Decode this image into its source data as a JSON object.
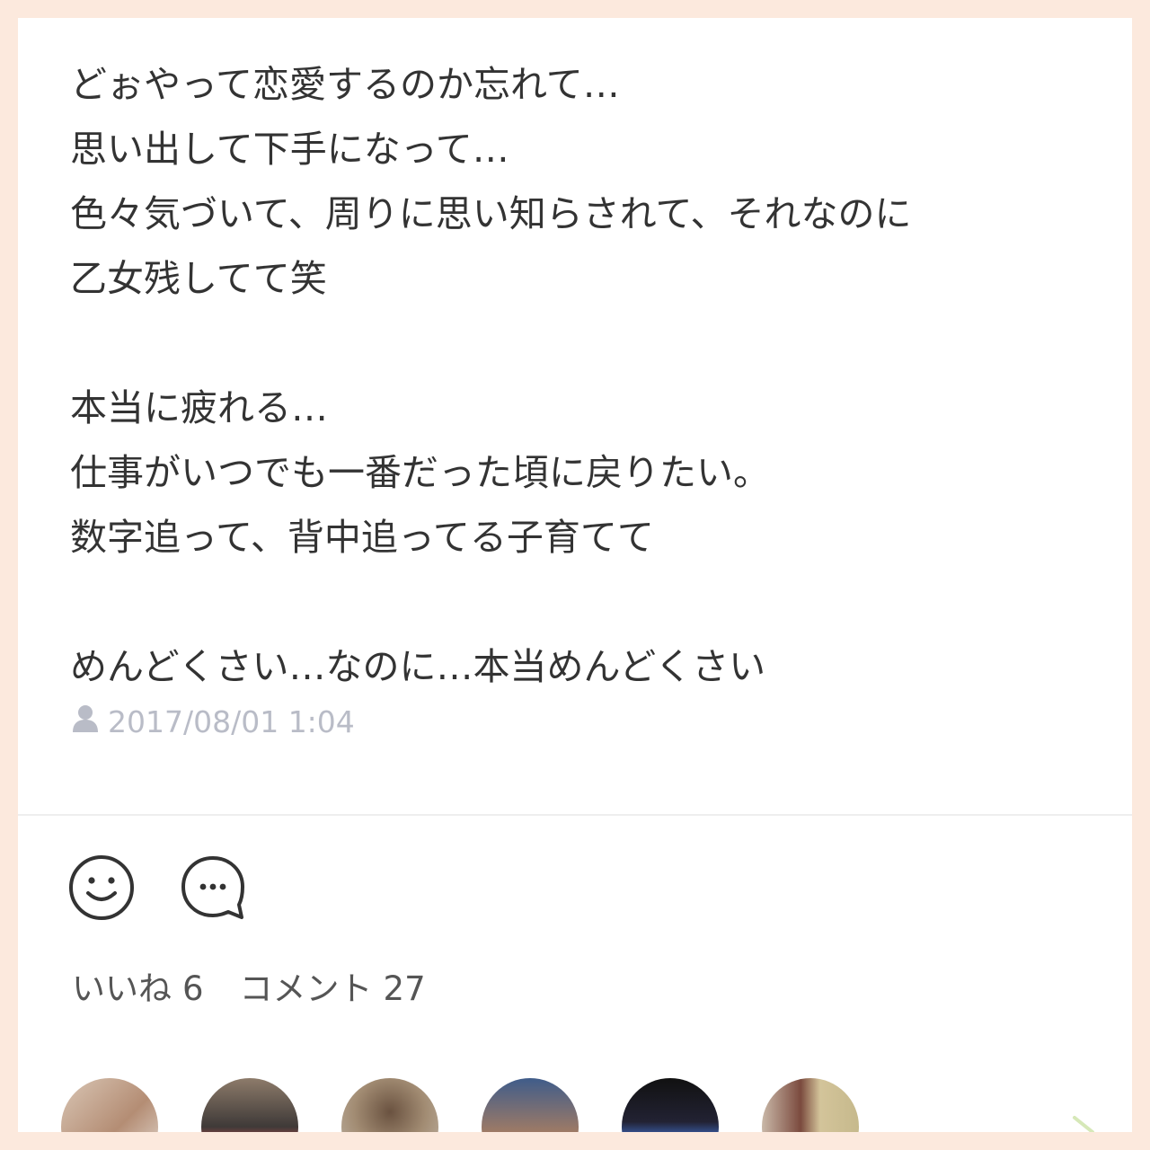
{
  "post": {
    "lines": [
      "どぉやって恋愛するのか忘れて…",
      "思い出して下手になって…",
      "色々気づいて、周りに思い知らされて、それなのに",
      "乙女残してて笑",
      "",
      "本当に疲れる…",
      "仕事がいつでも一番だった頃に戻りたい。",
      "数字追って、背中追ってる子育てて",
      "",
      "めんどくさい…なのに…本当めんどくさい"
    ],
    "timestamp": "2017/08/01 1:04"
  },
  "icons": {
    "author": "person-icon",
    "like": "smiley-icon",
    "comment": "speech-bubble-icon",
    "more": "chevron-right-icon"
  },
  "stats": {
    "likes_label": "いいね",
    "likes_count": "6",
    "comments_label": "コメント",
    "comments_count": "27"
  },
  "colors": {
    "page_background": "#fce9dd",
    "card_background": "#ffffff",
    "text": "#333333",
    "meta_text": "#b9bcc7",
    "icon": "#333333",
    "chevron": "#d6e8b8"
  },
  "avatars_count": 6
}
